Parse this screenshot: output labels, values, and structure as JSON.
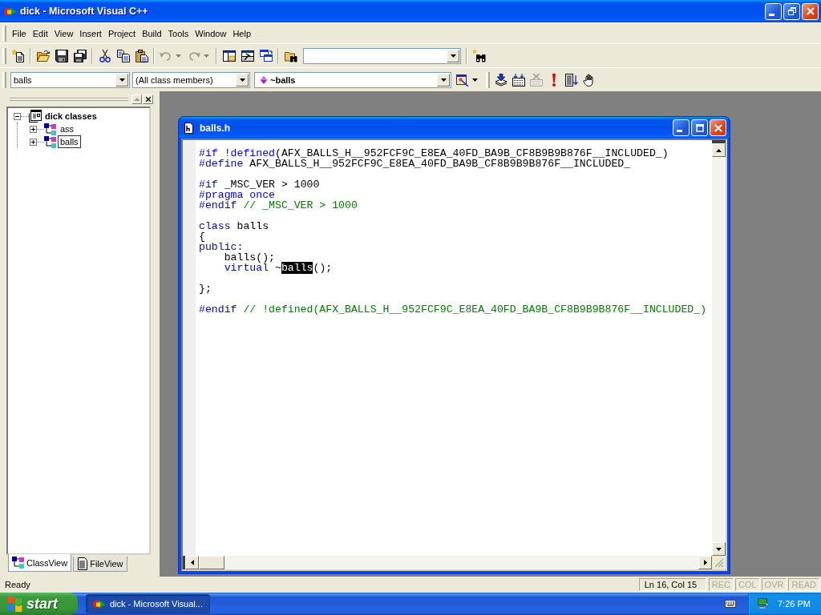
{
  "window": {
    "title": "dick - Microsoft Visual C++"
  },
  "menu": [
    "File",
    "Edit",
    "View",
    "Insert",
    "Project",
    "Build",
    "Tools",
    "Window",
    "Help"
  ],
  "standard_toolbar": [
    [
      {
        "kind": "button",
        "disabled": false
      }
    ],
    [
      {
        "kind": "button",
        "disabled": false
      },
      {
        "kind": "button",
        "disabled": false
      },
      {
        "kind": "button",
        "disabled": false
      }
    ],
    [
      {
        "kind": "button",
        "disabled": false
      },
      {
        "kind": "button",
        "disabled": false
      },
      {
        "kind": "button",
        "disabled": false
      }
    ],
    [
      {
        "kind": "split",
        "disabled": true
      },
      {
        "kind": "split",
        "disabled": true
      }
    ],
    [
      {
        "kind": "button",
        "disabled": false
      },
      {
        "kind": "button",
        "disabled": false
      },
      {
        "kind": "button",
        "disabled": false
      }
    ],
    [
      {
        "kind": "button",
        "disabled": false
      },
      {
        "kind": "combo"
      }
    ],
    [
      {
        "kind": "button",
        "disabled": false
      }
    ]
  ],
  "wizard_bar": [
    {
      "kind": "combo",
      "value": "balls"
    },
    {
      "kind": "combo",
      "value": "(All class members)"
    },
    {
      "kind": "member_combo",
      "value": "~balls"
    },
    {
      "kind": "split",
      "disabled": false
    }
  ],
  "build_toolbar": [
    {
      "disabled": false
    },
    {
      "disabled": false
    },
    {
      "disabled": true
    },
    {
      "disabled": false
    },
    {
      "disabled": false
    },
    {
      "disabled": false
    }
  ],
  "workspace": {
    "tree": [
      {
        "kind": "project",
        "label": "dick classes",
        "expanded": true,
        "selected": false,
        "children": [
          {
            "kind": "class",
            "label": "ass",
            "expanded": false,
            "selected": false
          },
          {
            "kind": "class",
            "label": "balls",
            "expanded": false,
            "selected": true
          }
        ]
      }
    ],
    "tabs": [
      {
        "label": "ClassView",
        "selected": true
      },
      {
        "label": "FileView",
        "selected": false
      }
    ]
  },
  "editor_window": {
    "title": "balls.h",
    "code_blocks": [
      [
        [
          {
            "kind": "keyword",
            "text": "#if"
          },
          {
            "kind": "plain",
            "text": " !"
          },
          {
            "kind": "keyword",
            "text": "defined"
          },
          {
            "kind": "plain",
            "text": "(AFX_BALLS_H__952FCF9C_E8EA_40FD_BA9B_CF8B9B9B876F__INCLUDED_)"
          }
        ],
        [
          {
            "kind": "keyword",
            "text": "#define"
          },
          {
            "kind": "plain",
            "text": " AFX_BALLS_H__952FCF9C_E8EA_40FD_BA9B_CF8B9B9B876F__INCLUDED_"
          }
        ]
      ],
      [
        [
          {
            "kind": "keyword",
            "text": "#if"
          },
          {
            "kind": "plain",
            "text": " _MSC_VER > 1000"
          }
        ],
        [
          {
            "kind": "keyword",
            "text": "#pragma once"
          }
        ],
        [
          {
            "kind": "keyword",
            "text": "#endif"
          },
          {
            "kind": "comment",
            "text": " // _MSC_VER > 1000"
          }
        ]
      ],
      [
        [
          {
            "kind": "keyword",
            "text": "class"
          },
          {
            "kind": "plain",
            "text": " balls"
          }
        ],
        [
          {
            "kind": "plain",
            "text": "{"
          }
        ],
        [
          {
            "kind": "keyword",
            "text": "public:"
          }
        ],
        [
          {
            "kind": "plain",
            "text": "    balls();"
          }
        ],
        [
          {
            "kind": "keyword",
            "text": "    virtual"
          },
          {
            "kind": "plain",
            "text": " ~"
          },
          {
            "kind": "selected",
            "text": "balls"
          },
          {
            "kind": "plain",
            "text": "();"
          }
        ]
      ],
      [
        [
          {
            "kind": "plain",
            "text": "};"
          }
        ]
      ],
      [
        [
          {
            "kind": "keyword",
            "text": "#endif"
          },
          {
            "kind": "comment",
            "text": " // !defined(AFX_BALLS_H__952FCF9C_E8EA_40FD_BA9B_CF8B9B9B876F__INCLUDED_)"
          }
        ]
      ]
    ]
  },
  "status_bar": {
    "message": "Ready",
    "position": "Ln 16, Col 15",
    "indicators": [
      {
        "label": "REC",
        "on": false
      },
      {
        "label": "COL",
        "on": false
      },
      {
        "label": "OVR",
        "on": false
      },
      {
        "label": "READ",
        "on": false
      }
    ]
  },
  "taskbar": {
    "start_label": "start",
    "tasks": [
      {
        "label": "dick - Microsoft Visual...",
        "selected": true
      }
    ],
    "clock": "7:26 PM"
  }
}
